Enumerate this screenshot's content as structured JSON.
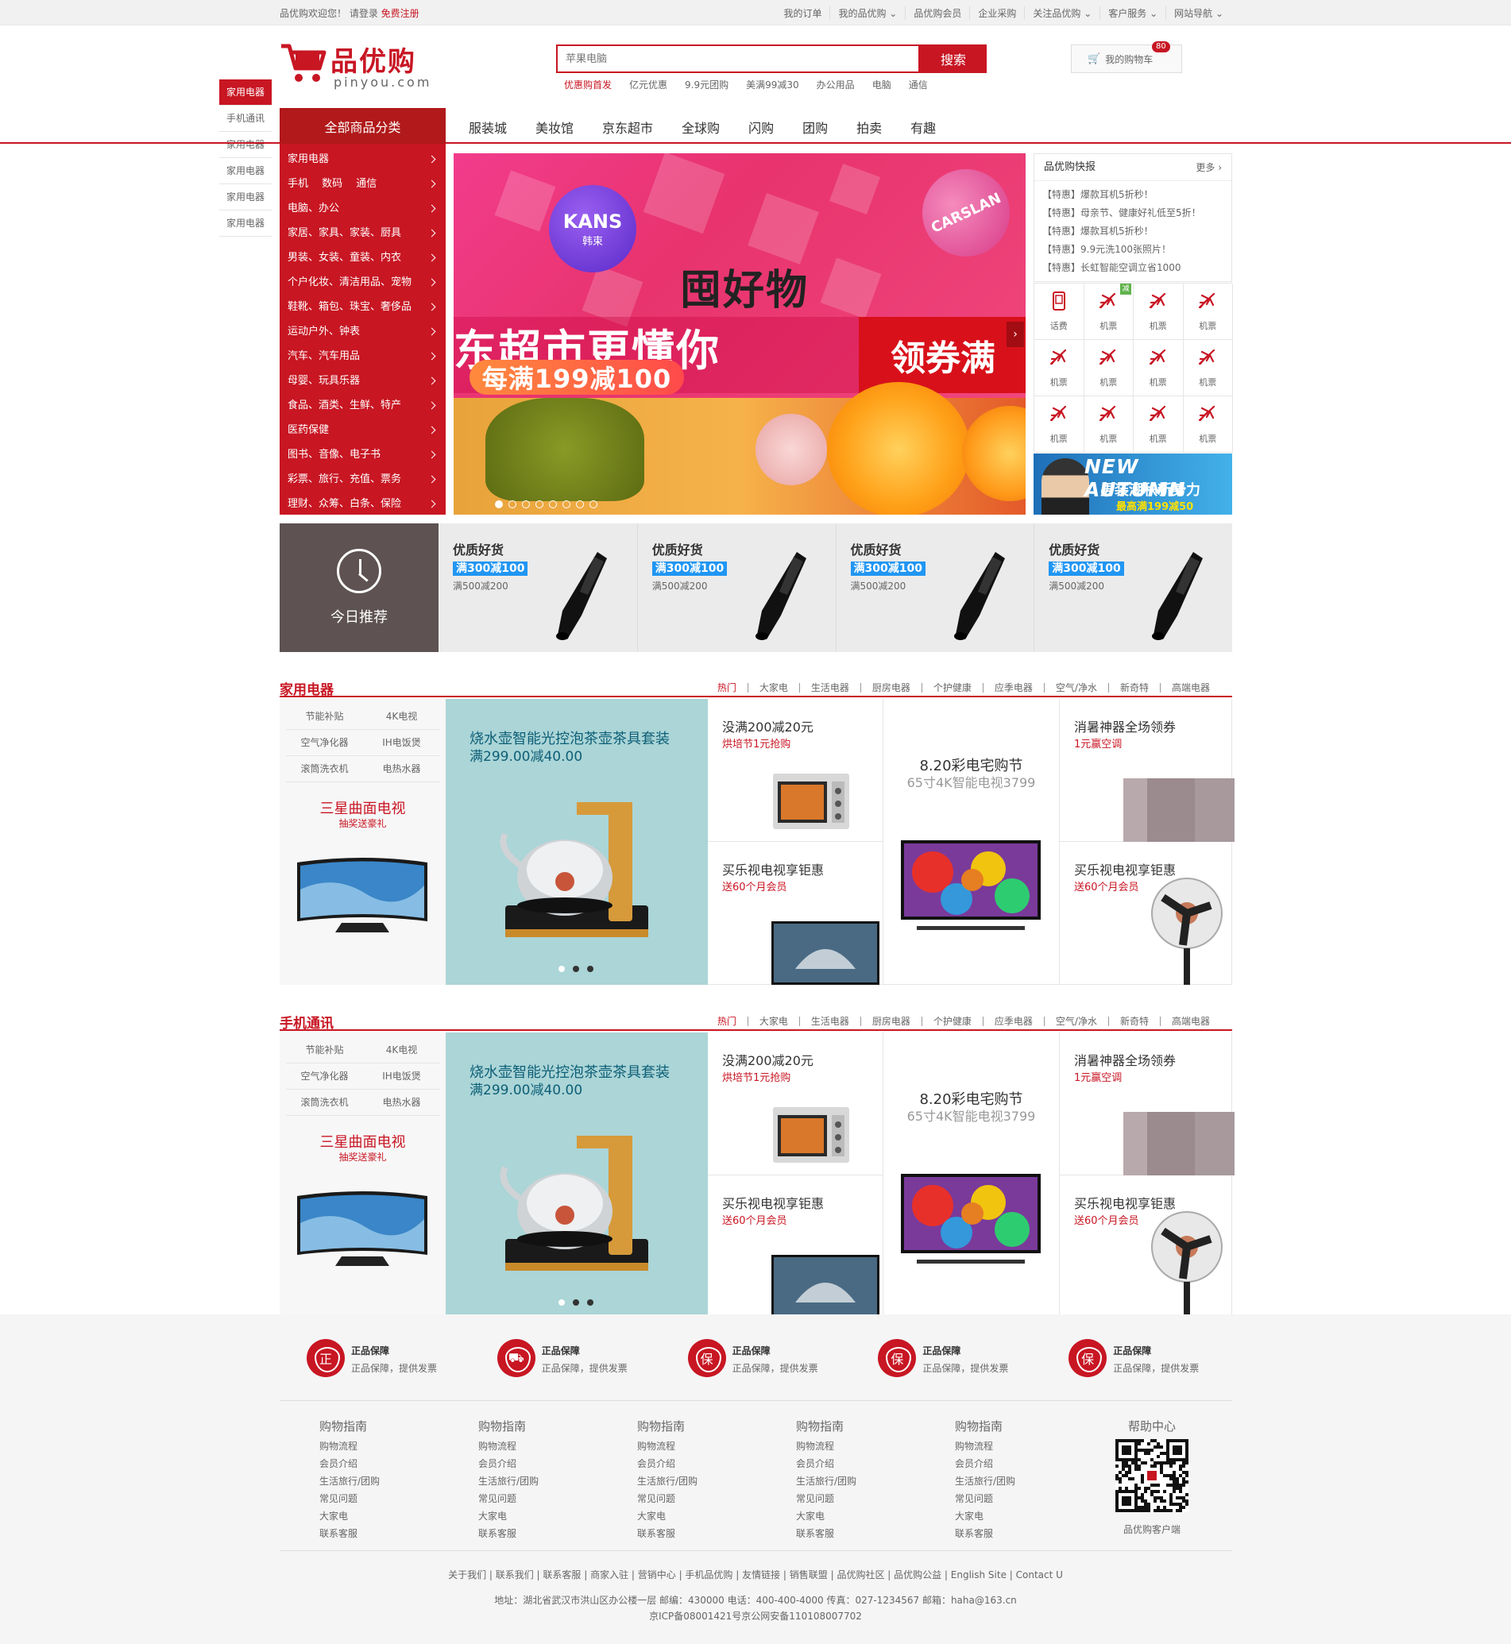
{
  "topbar": {
    "welcome": "品优购欢迎您！ 请登录",
    "register": "免费注册",
    "links": [
      "我的订单",
      "我的品优购 ⌄",
      "品优购会员",
      "企业采购",
      "关注品优购 ⌄",
      "客户服务 ⌄",
      "网站导航 ⌄"
    ]
  },
  "header": {
    "logo_text": "品优购",
    "logo_sub": "pinyou.com",
    "search_placeholder": "苹果电脑",
    "search_button": "搜索",
    "hotwords": [
      "优惠购首发",
      "亿元优惠",
      "9.9元团购",
      "美满99减30",
      "办公用品",
      "电脑",
      "通信"
    ],
    "cart_label": "我的购物车",
    "cart_count": "80"
  },
  "elevator": [
    "家用电器",
    "手机通讯",
    "家用电器",
    "家用电器",
    "家用电器",
    "家用电器"
  ],
  "nav": {
    "all_categories": "全部商品分类",
    "items": [
      "服装城",
      "美妆馆",
      "京东超市",
      "全球购",
      "闪购",
      "团购",
      "拍卖",
      "有趣"
    ]
  },
  "categories": [
    "家用电器",
    "手机　 数码　 通信",
    "电脑、办公",
    "家居、家具、家装、厨具",
    "男装、女装、童装、内衣",
    "个户化妆、清洁用品、宠物",
    "鞋靴、箱包、珠宝、奢侈品",
    "运动户外、钟表",
    "汽车、汽车用品",
    "母婴、玩具乐器",
    "食品、酒类、生鲜、特产",
    "医药保健",
    "图书、音像、电子书",
    "彩票、旅行、充值、票务",
    "理财、众筹、白条、保险"
  ],
  "banner": {
    "brand1": "KANS",
    "brand1_sub": "韩束",
    "brand2": "CARSLAN",
    "headline": "囤好物",
    "line1": "东超市更懂你",
    "promo": "每满199减100",
    "coupon": "领券满",
    "next_icon": "chevron-right",
    "slide_count": 8,
    "active_slide": 1
  },
  "news": {
    "title": "品优购快报",
    "more": "更多 ›",
    "items": [
      "【特惠】爆款耳机5折秒！",
      "【特惠】母亲节、健康好礼低至5折！",
      "【特惠】爆款耳机5折秒！",
      "【特惠】9.9元洗100张照片！",
      "【特惠】长虹智能空调立省1000"
    ]
  },
  "services": [
    {
      "label": "话费",
      "icon": "phone-icon"
    },
    {
      "label": "机票",
      "icon": "plane-icon",
      "badge": "减"
    },
    {
      "label": "机票",
      "icon": "plane-icon"
    },
    {
      "label": "机票",
      "icon": "plane-icon"
    },
    {
      "label": "机票",
      "icon": "plane-icon"
    },
    {
      "label": "机票",
      "icon": "plane-icon"
    },
    {
      "label": "机票",
      "icon": "plane-icon"
    },
    {
      "label": "机票",
      "icon": "plane-icon"
    },
    {
      "label": "机票",
      "icon": "plane-icon"
    },
    {
      "label": "机票",
      "icon": "plane-icon"
    },
    {
      "label": "机票",
      "icon": "plane-icon"
    },
    {
      "label": "机票",
      "icon": "plane-icon"
    }
  ],
  "autumn_ad": {
    "title": "NEW AUTUMN",
    "sub": "男装潮秋新势力",
    "promo": "最高满199减50"
  },
  "today": {
    "label": "今日推荐",
    "items": [
      {
        "title": "优质好货",
        "tag": "满300减100",
        "sub": "满500减200"
      },
      {
        "title": "优质好货",
        "tag": "满300减100",
        "sub": "满500减200"
      },
      {
        "title": "优质好货",
        "tag": "满300减100",
        "sub": "满500减200"
      },
      {
        "title": "优质好货",
        "tag": "满300减100",
        "sub": "满500减200"
      }
    ]
  },
  "floors": [
    {
      "title": "家用电器",
      "tabs": [
        "热门",
        "大家电",
        "生活电器",
        "厨房电器",
        "个护健康",
        "应季电器",
        "空气/净水",
        "新奇特",
        "高端电器"
      ],
      "tags": [
        "节能补贴",
        "4K电视",
        "空气净化器",
        "IH电饭煲",
        "滚筒洗衣机",
        "电热水器"
      ],
      "tv_title": "三星曲面电视",
      "tv_sub": "抽奖送豪礼",
      "mid_title": "烧水壶智能光控泡茶壶茶具套装",
      "mid_price": "满299.00减40.00",
      "cells": [
        {
          "title": "没满200减20元",
          "sub": "烘培节1元抢购"
        },
        {
          "title": "8.20彩电宅购节",
          "sub": "65寸4K智能电视3799"
        },
        {
          "title": "消暑神器全场领券",
          "sub": "1元赢空调"
        },
        {
          "title": "买乐视电视享钜惠",
          "sub": "送60个月会员"
        },
        {
          "title": "买乐视电视享钜惠",
          "sub": "送60个月会员"
        }
      ]
    },
    {
      "title": "手机通讯",
      "tabs": [
        "热门",
        "大家电",
        "生活电器",
        "厨房电器",
        "个护健康",
        "应季电器",
        "空气/净水",
        "新奇特",
        "高端电器"
      ],
      "tags": [
        "节能补贴",
        "4K电视",
        "空气净化器",
        "IH电饭煲",
        "滚筒洗衣机",
        "电热水器"
      ],
      "tv_title": "三星曲面电视",
      "tv_sub": "抽奖送豪礼",
      "mid_title": "烧水壶智能光控泡茶壶茶具套装",
      "mid_price": "满299.00减40.00",
      "cells": [
        {
          "title": "没满200减20元",
          "sub": "烘培节1元抢购"
        },
        {
          "title": "8.20彩电宅购节",
          "sub": "65寸4K智能电视3799"
        },
        {
          "title": "消暑神器全场领券",
          "sub": "1元赢空调"
        },
        {
          "title": "买乐视电视享钜惠",
          "sub": "送60个月会员"
        },
        {
          "title": "买乐视电视享钜惠",
          "sub": "送60个月会员"
        }
      ]
    }
  ],
  "footer": {
    "promises": [
      {
        "icon": "正",
        "title": "正品保障",
        "sub": "正品保障，提供发票"
      },
      {
        "icon": "⛟",
        "title": "正品保障",
        "sub": "正品保障，提供发票"
      },
      {
        "icon": "保",
        "title": "正品保障",
        "sub": "正品保障，提供发票"
      },
      {
        "icon": "保",
        "title": "正品保障",
        "sub": "正品保障，提供发票"
      },
      {
        "icon": "保",
        "title": "正品保障",
        "sub": "正品保障，提供发票"
      }
    ],
    "columns": [
      {
        "title": "购物指南",
        "links": [
          "购物流程",
          "会员介绍",
          "生活旅行/团购",
          "常见问题",
          "大家电",
          "联系客服"
        ]
      },
      {
        "title": "购物指南",
        "links": [
          "购物流程",
          "会员介绍",
          "生活旅行/团购",
          "常见问题",
          "大家电",
          "联系客服"
        ]
      },
      {
        "title": "购物指南",
        "links": [
          "购物流程",
          "会员介绍",
          "生活旅行/团购",
          "常见问题",
          "大家电",
          "联系客服"
        ]
      },
      {
        "title": "购物指南",
        "links": [
          "购物流程",
          "会员介绍",
          "生活旅行/团购",
          "常见问题",
          "大家电",
          "联系客服"
        ]
      },
      {
        "title": "购物指南",
        "links": [
          "购物流程",
          "会员介绍",
          "生活旅行/团购",
          "常见问题",
          "大家电",
          "联系客服"
        ]
      }
    ],
    "help_title": "帮助中心",
    "qr_caption": "品优购客户端",
    "links_line": "关于我们 | 联系我们 | 联系客服 | 商家入驻 | 营销中心 | 手机品优购 | 友情链接 | 销售联盟 | 品优购社区 | 品优购公益 | English Site | Contact U",
    "address": "地址：湖北省武汉市洪山区办公楼一层 邮编：430000 电话：400-400-4000 传真：027-1234567 邮箱：haha@163.cn",
    "icp": "京ICP备08001421号京公网安备110108007702"
  },
  "colors": {
    "brand": "#c81623",
    "nav_dark": "#b1191a",
    "today_bg": "#5e5252",
    "kettle_bg": "#abd5d7",
    "tag_blue": "#2196f3"
  }
}
